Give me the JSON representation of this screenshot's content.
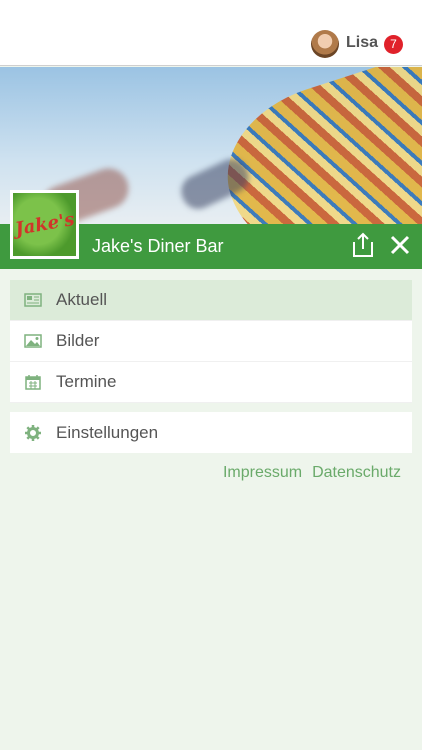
{
  "user": {
    "name": "Lisa",
    "notifications": "7"
  },
  "header": {
    "title": "Jake's Diner Bar",
    "logo_text": "Jake's"
  },
  "menu": {
    "items": [
      {
        "label": "Aktuell",
        "icon": "newspaper-icon",
        "active": true
      },
      {
        "label": "Bilder",
        "icon": "image-icon",
        "active": false
      },
      {
        "label": "Termine",
        "icon": "calendar-icon",
        "active": false
      }
    ],
    "settings": {
      "label": "Einstellungen",
      "icon": "gear-icon"
    }
  },
  "footer": {
    "impressum": "Impressum",
    "datenschutz": "Datenschutz"
  },
  "colors": {
    "brand_green": "#3f9a3f",
    "active_bg": "#dcebd9",
    "background": "#eef5ec",
    "badge_red": "#e0212a"
  }
}
